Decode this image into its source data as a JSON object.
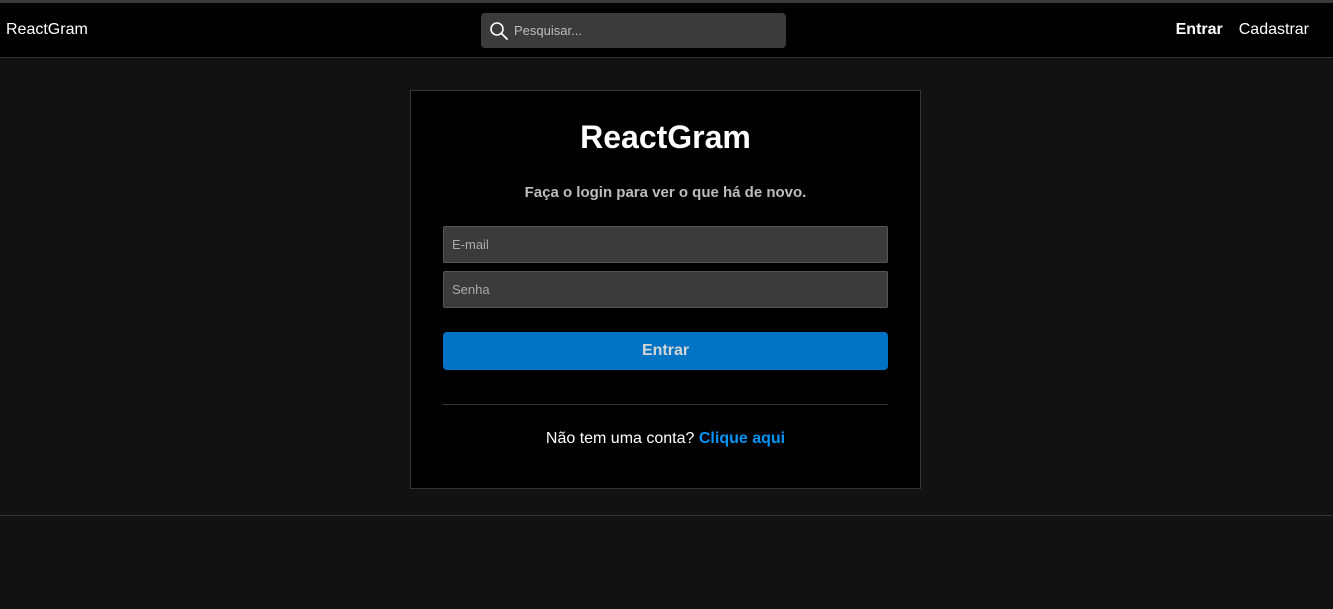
{
  "navbar": {
    "brand": "ReactGram",
    "search_placeholder": "Pesquisar...",
    "links": {
      "login": "Entrar",
      "register": "Cadastrar"
    }
  },
  "login": {
    "title": "ReactGram",
    "subtitle": "Faça o login para ver o que há de novo.",
    "email_placeholder": "E-mail",
    "password_placeholder": "Senha",
    "submit_label": "Entrar",
    "no_account_text": "Não tem uma conta?",
    "register_link": "Clique aqui"
  },
  "colors": {
    "background": "#121212",
    "navbar": "#000000",
    "primary_button": "#0073c5",
    "link": "#0094f6"
  },
  "icons": {
    "search": "search-icon"
  }
}
